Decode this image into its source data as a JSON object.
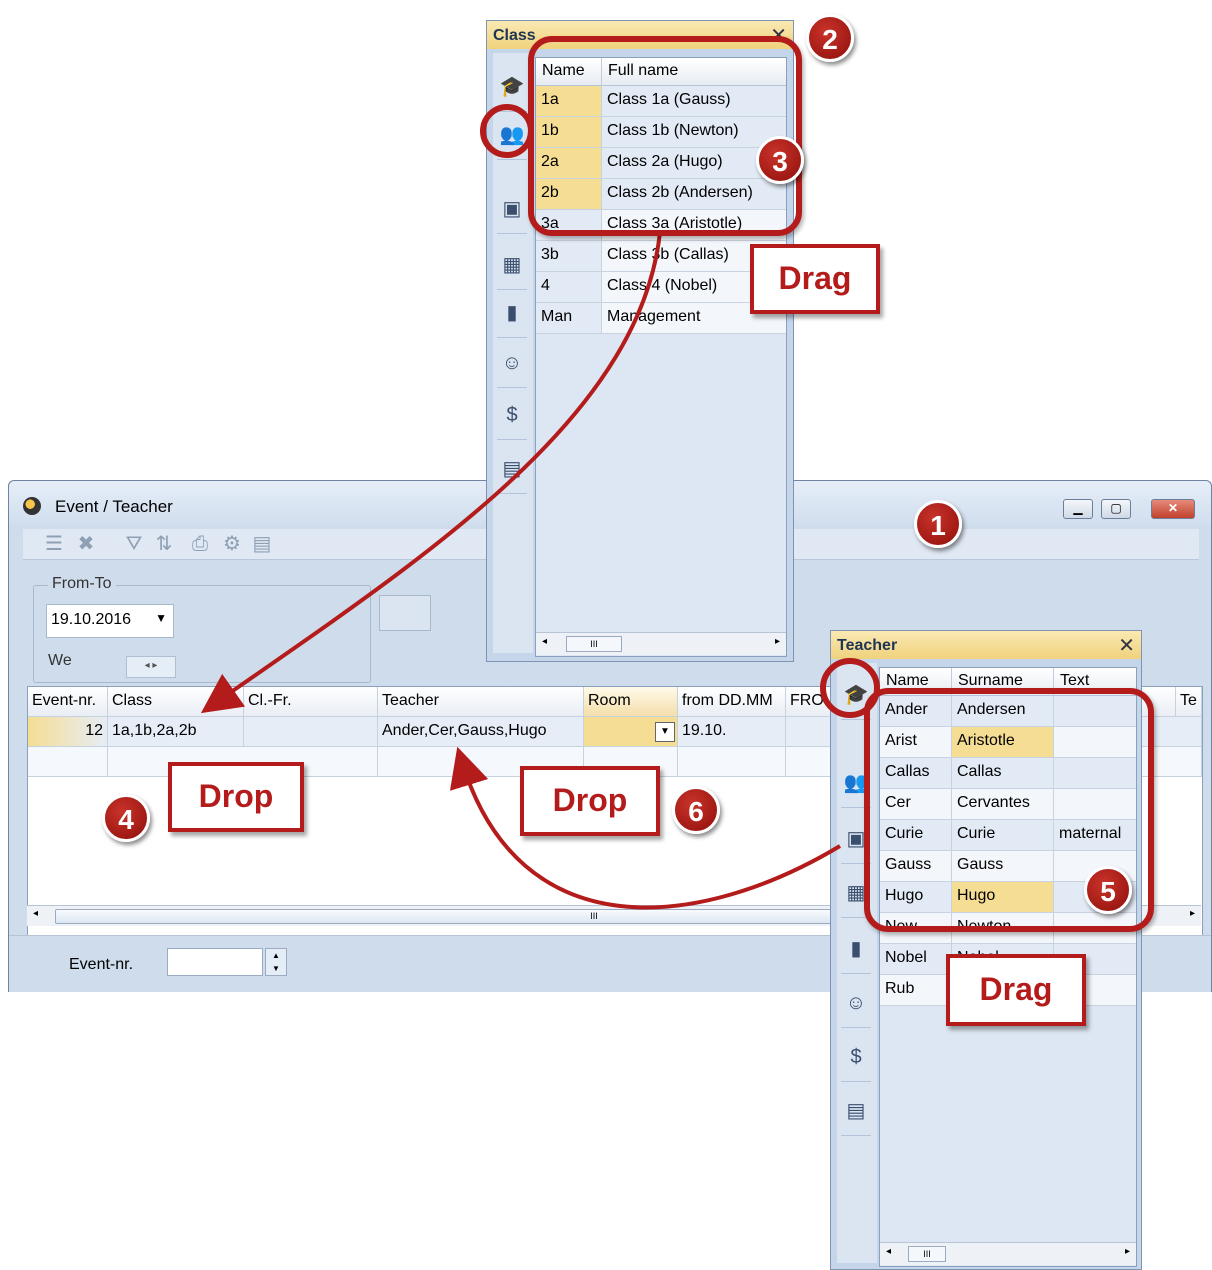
{
  "main_window": {
    "title": "Event / Teacher",
    "fromto_label": "From-To",
    "date": "19.10.2016",
    "weekday": "We",
    "columns": [
      "Event-nr.",
      "Class",
      "Cl.-Fr.",
      "Teacher",
      "Room",
      "from DD.MM",
      "FRO",
      "Te"
    ],
    "row": {
      "event_nr": "12",
      "class": "1a,1b,2a,2b",
      "cl_fr": "",
      "teacher": "Ander,Cer,Gauss,Hugo",
      "room": "",
      "from": "19.10."
    },
    "status_label": "Event-nr.",
    "scroll_thumb": "III"
  },
  "class_panel": {
    "title": "Class",
    "columns": [
      "Name",
      "Full name"
    ],
    "rows": [
      {
        "name": "1a",
        "full": "Class 1a (Gauss)",
        "hl": true
      },
      {
        "name": "1b",
        "full": "Class 1b (Newton)",
        "hl": true
      },
      {
        "name": "2a",
        "full": "Class 2a (Hugo)",
        "hl": true
      },
      {
        "name": "2b",
        "full": "Class 2b (Andersen)",
        "hl": true
      },
      {
        "name": "3a",
        "full": "Class 3a (Aristotle)",
        "hl": false
      },
      {
        "name": "3b",
        "full": "Class 3b (Callas)",
        "hl": false
      },
      {
        "name": "4",
        "full": "Class 4 (Nobel)",
        "hl": false
      },
      {
        "name": "Man",
        "full": "Management",
        "hl": false
      }
    ],
    "scroll_thumb": "III"
  },
  "teacher_panel": {
    "title": "Teacher",
    "columns": [
      "Name",
      "Surname",
      "Text"
    ],
    "rows": [
      {
        "name": "Ander",
        "surname": "Andersen",
        "text": "",
        "hl": false
      },
      {
        "name": "Arist",
        "surname": "Aristotle",
        "text": "",
        "hl": true
      },
      {
        "name": "Callas",
        "surname": "Callas",
        "text": "",
        "hl": false
      },
      {
        "name": "Cer",
        "surname": "Cervantes",
        "text": "",
        "hl": false
      },
      {
        "name": "Curie",
        "surname": "Curie",
        "text": "maternal",
        "hl": false
      },
      {
        "name": "Gauss",
        "surname": "Gauss",
        "text": "",
        "hl": false
      },
      {
        "name": "Hugo",
        "surname": "Hugo",
        "text": "",
        "hl": true
      },
      {
        "name": "New",
        "surname": "Newton",
        "text": "",
        "hl": false
      },
      {
        "name": "Nobel",
        "surname": "Nobel",
        "text": "",
        "hl": false
      },
      {
        "name": "Rub",
        "surname": "",
        "text": "",
        "hl": false
      }
    ],
    "scroll_thumb": "III"
  },
  "annotations": {
    "badges": [
      "1",
      "2",
      "3",
      "4",
      "5",
      "6"
    ],
    "drag_label": "Drag",
    "drop_label": "Drop"
  },
  "colors": {
    "accent_red": "#b41c1c",
    "highlight": "#f6dd94",
    "window_bg": "#cfdcec"
  }
}
